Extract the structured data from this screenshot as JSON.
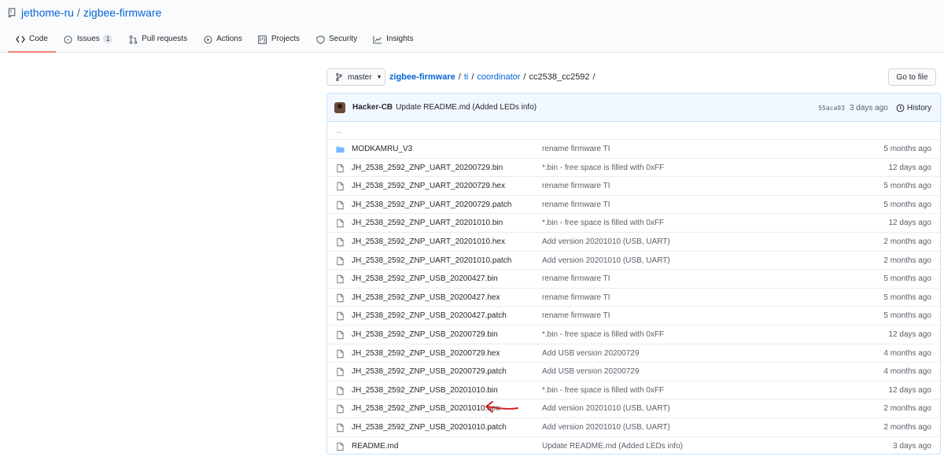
{
  "repo": {
    "owner": "jethome-ru",
    "separator": "/",
    "name": "zigbee-firmware"
  },
  "tabs": [
    {
      "label": "Code",
      "icon": "code-icon",
      "active": true
    },
    {
      "label": "Issues",
      "icon": "issue-icon",
      "counter": "1"
    },
    {
      "label": "Pull requests",
      "icon": "pull-request-icon"
    },
    {
      "label": "Actions",
      "icon": "play-icon"
    },
    {
      "label": "Projects",
      "icon": "project-icon"
    },
    {
      "label": "Security",
      "icon": "shield-icon"
    },
    {
      "label": "Insights",
      "icon": "graph-icon"
    }
  ],
  "branch": {
    "label": "master"
  },
  "breadcrumb": {
    "root": "zigbee-firmware",
    "parts": [
      "ti",
      "coordinator"
    ],
    "current": "cc2538_cc2592",
    "separator": "/"
  },
  "goto_file": "Go to file",
  "commit": {
    "author": "Hacker-CB",
    "message": "Update README.md (Added LEDs info)",
    "sha": "55aca93",
    "time": "3 days ago",
    "history_label": "History"
  },
  "parent_dir": "..",
  "files": [
    {
      "type": "dir",
      "name": "MODKAMRU_V3",
      "message": "rename firmware TI",
      "age": "5 months ago"
    },
    {
      "type": "file",
      "name": "JH_2538_2592_ZNP_UART_20200729.bin",
      "message": "*.bin - free space is filled with 0xFF",
      "age": "12 days ago"
    },
    {
      "type": "file",
      "name": "JH_2538_2592_ZNP_UART_20200729.hex",
      "message": "rename firmware TI",
      "age": "5 months ago"
    },
    {
      "type": "file",
      "name": "JH_2538_2592_ZNP_UART_20200729.patch",
      "message": "rename firmware TI",
      "age": "5 months ago"
    },
    {
      "type": "file",
      "name": "JH_2538_2592_ZNP_UART_20201010.bin",
      "message": "*.bin - free space is filled with 0xFF",
      "age": "12 days ago"
    },
    {
      "type": "file",
      "name": "JH_2538_2592_ZNP_UART_20201010.hex",
      "message": "Add version 20201010 (USB, UART)",
      "age": "2 months ago"
    },
    {
      "type": "file",
      "name": "JH_2538_2592_ZNP_UART_20201010.patch",
      "message": "Add version 20201010 (USB, UART)",
      "age": "2 months ago"
    },
    {
      "type": "file",
      "name": "JH_2538_2592_ZNP_USB_20200427.bin",
      "message": "rename firmware TI",
      "age": "5 months ago"
    },
    {
      "type": "file",
      "name": "JH_2538_2592_ZNP_USB_20200427.hex",
      "message": "rename firmware TI",
      "age": "5 months ago"
    },
    {
      "type": "file",
      "name": "JH_2538_2592_ZNP_USB_20200427.patch",
      "message": "rename firmware TI",
      "age": "5 months ago"
    },
    {
      "type": "file",
      "name": "JH_2538_2592_ZNP_USB_20200729.bin",
      "message": "*.bin - free space is filled with 0xFF",
      "age": "12 days ago"
    },
    {
      "type": "file",
      "name": "JH_2538_2592_ZNP_USB_20200729.hex",
      "message": "Add USB version 20200729",
      "age": "4 months ago"
    },
    {
      "type": "file",
      "name": "JH_2538_2592_ZNP_USB_20200729.patch",
      "message": "Add USB version 20200729",
      "age": "4 months ago"
    },
    {
      "type": "file",
      "name": "JH_2538_2592_ZNP_USB_20201010.bin",
      "message": "*.bin - free space is filled with 0xFF",
      "age": "12 days ago"
    },
    {
      "type": "file",
      "name": "JH_2538_2592_ZNP_USB_20201010.hex",
      "message": "Add version 20201010 (USB, UART)",
      "age": "2 months ago"
    },
    {
      "type": "file",
      "name": "JH_2538_2592_ZNP_USB_20201010.patch",
      "message": "Add version 20201010 (USB, UART)",
      "age": "2 months ago"
    },
    {
      "type": "file",
      "name": "README.md",
      "message": "Update README.md (Added LEDs info)",
      "age": "3 days ago"
    }
  ],
  "colors": {
    "link": "#0366d6",
    "folder": "#79b8ff",
    "active_tab_underline": "#f9826c",
    "annotation_arrow": "#cc2222"
  }
}
